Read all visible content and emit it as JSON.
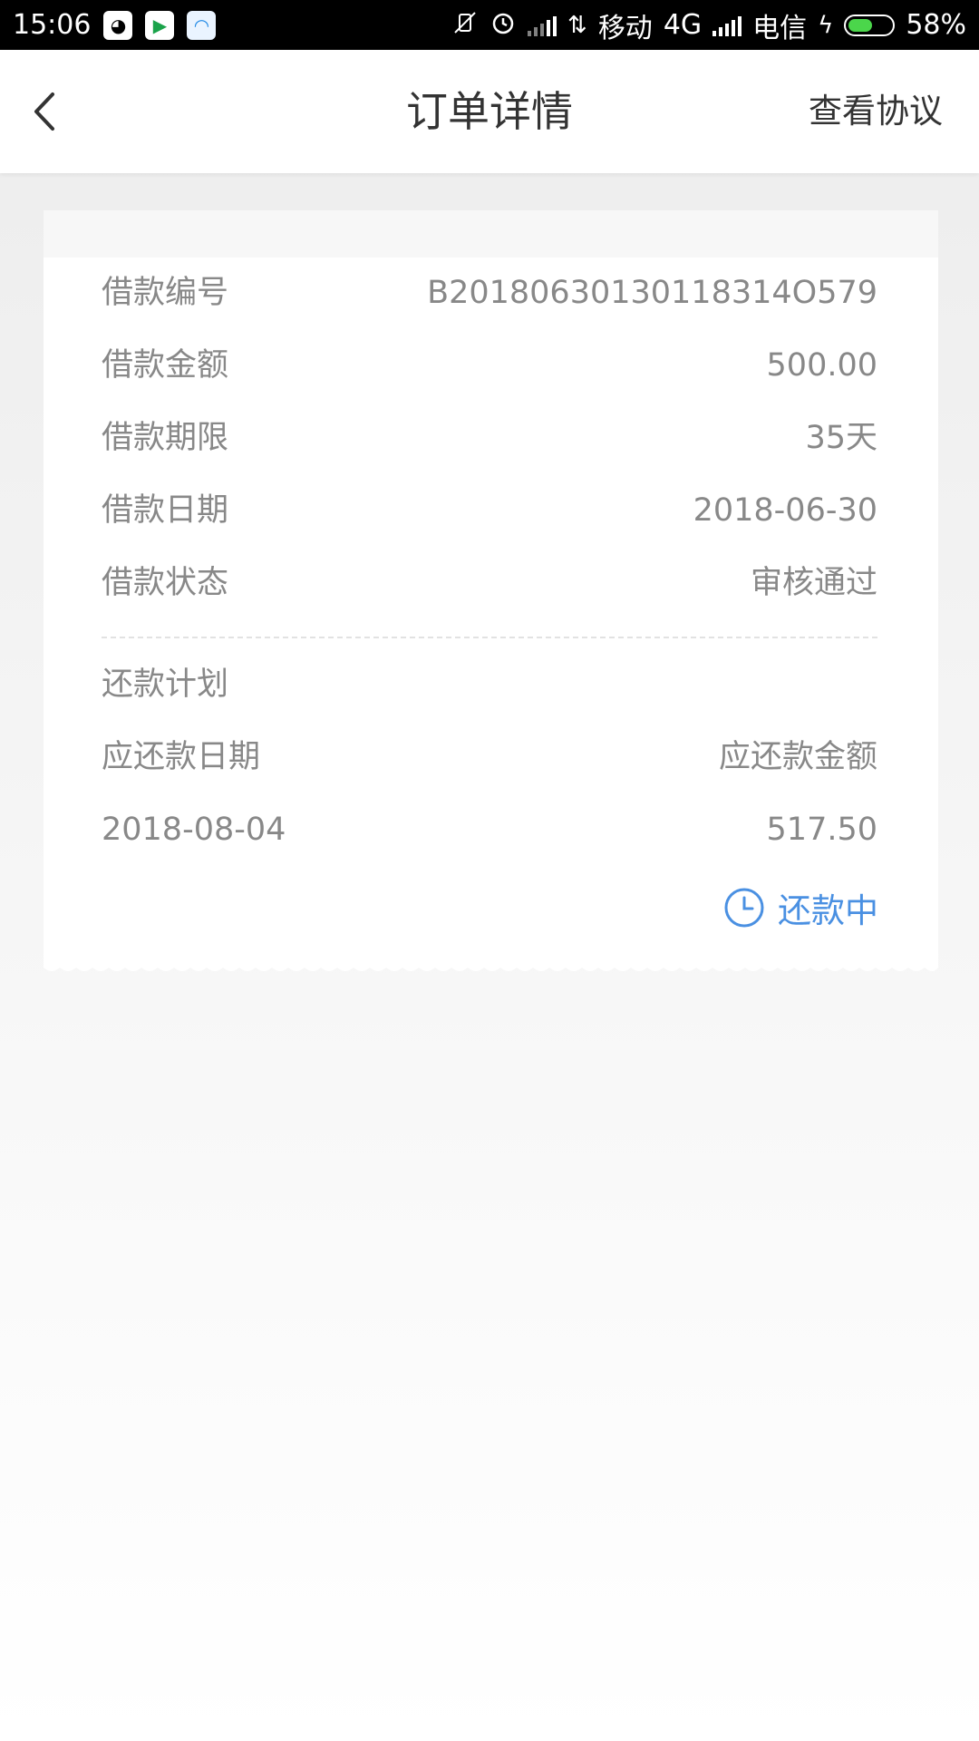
{
  "status_bar": {
    "time": "15:06",
    "carrier1": "移动",
    "network1": "4G",
    "carrier2": "电信",
    "battery_percent": "58%",
    "battery_level": 0.58,
    "icons": [
      "qq-icon",
      "video-app-icon",
      "browser-app-icon",
      "mute-vibrate-icon",
      "alarm-icon",
      "signal-icon",
      "data-arrows-icon",
      "signal-icon",
      "charging-icon",
      "battery-icon"
    ]
  },
  "header": {
    "title": "订单详情",
    "right_link": "查看协议",
    "back_icon": "chevron-left-icon"
  },
  "loan": {
    "rows": [
      {
        "label": "借款编号",
        "value": "B20180630130118314O579"
      },
      {
        "label": "借款金额",
        "value": "500.00"
      },
      {
        "label": "借款期限",
        "value": "35天"
      },
      {
        "label": "借款日期",
        "value": "2018-06-30"
      },
      {
        "label": "借款状态",
        "value": "审核通过"
      }
    ]
  },
  "repayment": {
    "section_title": "还款计划",
    "col_date": "应还款日期",
    "col_amount": "应还款金额",
    "date": "2018-08-04",
    "amount": "517.50",
    "status": "还款中",
    "status_icon": "clock-icon",
    "accent_color": "#4a90e2"
  }
}
